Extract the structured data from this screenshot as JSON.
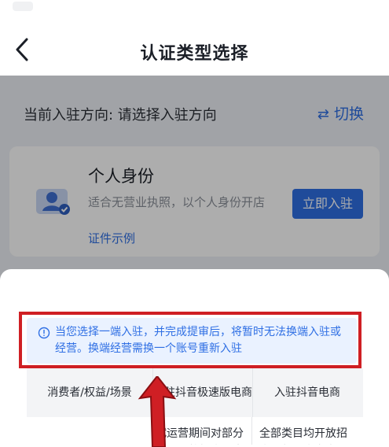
{
  "header": {
    "title": "认证类型选择"
  },
  "page": {
    "direction_text": "当前入驻方向: 请选择入驻方向",
    "switch_label": "切换",
    "card": {
      "title": "个人身份",
      "description": "适合无营业执照，以个人身份开店",
      "example_link": "证件示例",
      "enter_button": "立即入驻"
    }
  },
  "sheet": {
    "notice": "当您选择一端入驻，并完成提审后，将暂时无法换端入驻或经营。换端经营需换一个账号重新入驻",
    "table": {
      "headers": [
        "消费者/权益/场景",
        "入驻抖音极速版电商",
        "入驻抖音电商"
      ],
      "rows": [
        [
          "",
          "试运营期间对部分类目开放招商，全",
          "全部类目均开放招商，部分商家类目"
        ]
      ]
    }
  },
  "colors": {
    "accent": "#2f6fe4",
    "highlight": "#cf1f24",
    "notice_bg": "#eaf2ff"
  },
  "icons": {
    "back": "chevron-left-icon",
    "switch": "swap-arrows-icon",
    "avatar": "person-id-icon",
    "notice": "info-circle-icon",
    "annotation": "red-arrow-icon"
  }
}
